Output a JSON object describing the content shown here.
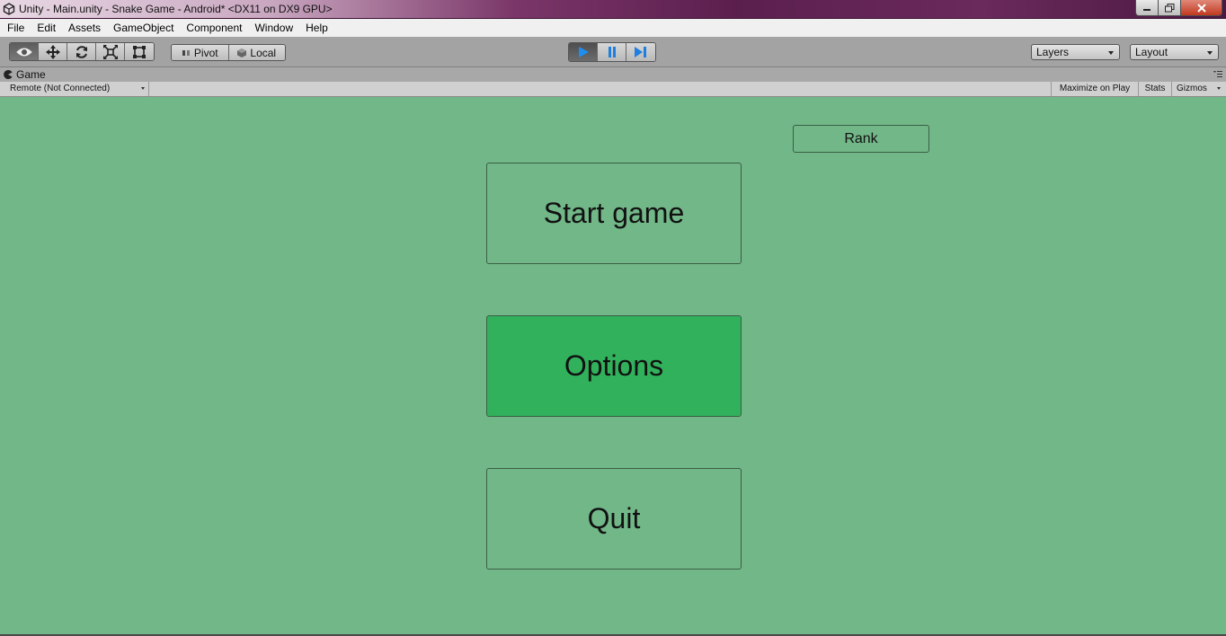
{
  "window": {
    "title": "Unity - Main.unity - Snake Game - Android* <DX11 on DX9 GPU>",
    "icon": "unity-icon"
  },
  "menu": [
    "File",
    "Edit",
    "Assets",
    "GameObject",
    "Component",
    "Window",
    "Help"
  ],
  "toolbar": {
    "tools": [
      "view-eye-icon",
      "move-icon",
      "rotate-icon",
      "scale-icon",
      "rect-icon"
    ],
    "pivot_label": "Pivot",
    "local_label": "Local",
    "playback": [
      "play-icon",
      "pause-icon",
      "step-icon"
    ],
    "layers_label": "Layers",
    "layout_label": "Layout"
  },
  "game_panel": {
    "tab_label": "Game",
    "remote_label": "Remote (Not Connected)",
    "maximize_label": "Maximize on Play",
    "stats_label": "Stats",
    "gizmos_label": "Gizmos"
  },
  "game": {
    "rank_label": "Rank",
    "start_label": "Start game",
    "options_label": "Options",
    "quit_label": "Quit",
    "background_color": "#72b788",
    "highlight_color": "#31b15c"
  }
}
